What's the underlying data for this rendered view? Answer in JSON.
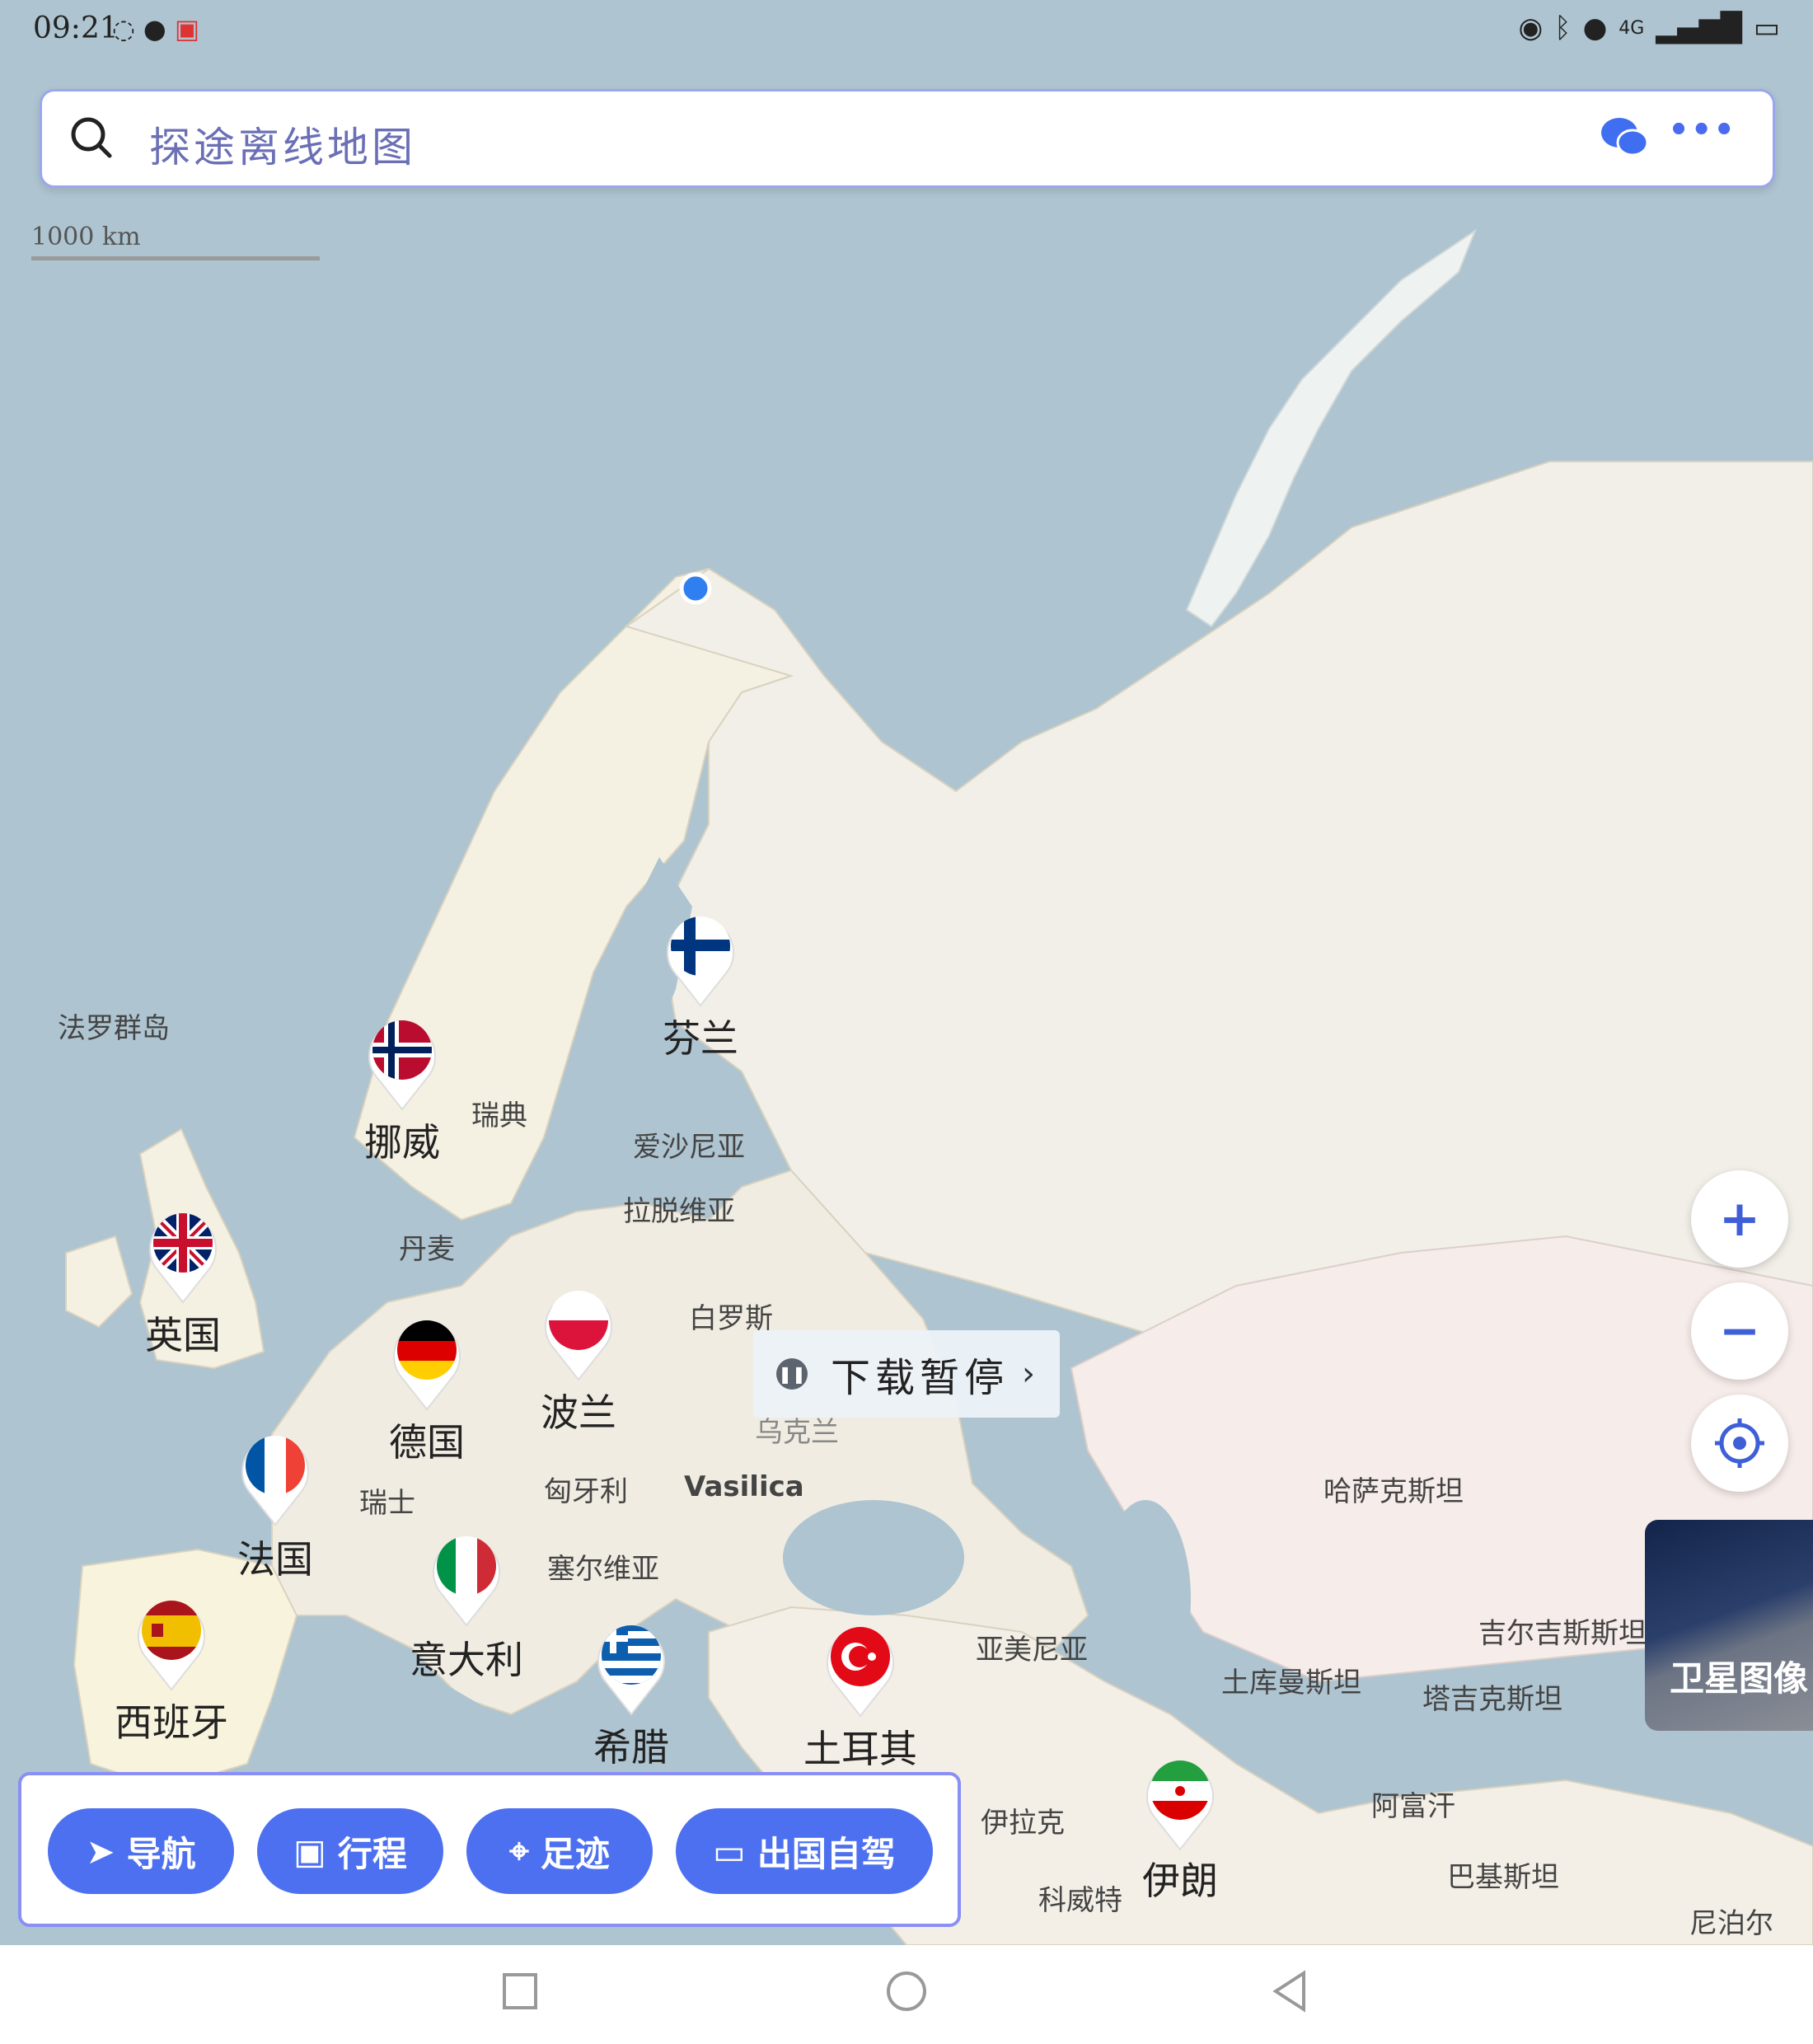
{
  "status_bar": {
    "time": "09:21",
    "network": "4G"
  },
  "search": {
    "placeholder": "探途离线地图"
  },
  "scale": {
    "label": "1000 km"
  },
  "download_status": {
    "label": "下载暂停"
  },
  "map_labels": {
    "faroe": "法罗群岛",
    "sweden": "瑞典",
    "estonia": "爱沙尼亚",
    "latvia": "拉脱维亚",
    "denmark": "丹麦",
    "belarus": "白罗斯",
    "ukraine": "乌克兰",
    "switzerland": "瑞士",
    "hungary": "匈牙利",
    "vasilica": "Vasilica",
    "serbia": "塞尔维亚",
    "armenia": "亚美尼亚",
    "kazakhstan": "哈萨克斯坦",
    "kyrgyzstan": "吉尔吉斯斯坦",
    "turkmenistan": "土库曼斯坦",
    "tajikistan": "塔吉克斯坦",
    "afghanistan": "阿富汗",
    "iraq": "伊拉克",
    "kuwait": "科威特",
    "pakistan": "巴基斯坦",
    "nepal": "尼泊尔"
  },
  "countries": {
    "finland": "芬兰",
    "norway": "挪威",
    "uk": "英国",
    "germany": "德国",
    "poland": "波兰",
    "france": "法国",
    "italy": "意大利",
    "spain": "西班牙",
    "greece": "希腊",
    "turkey": "土耳其",
    "iran": "伊朗"
  },
  "map_controls": {
    "satellite_label": "卫星图像"
  },
  "toolbar": {
    "navigate": "导航",
    "trip": "行程",
    "footprint": "足迹",
    "abroad_drive": "出国自驾"
  },
  "colors": {
    "accent": "#4d70f0",
    "water": "#aec4d0",
    "land": "#f4f0e4",
    "location_dot": "#2f7ff0"
  }
}
